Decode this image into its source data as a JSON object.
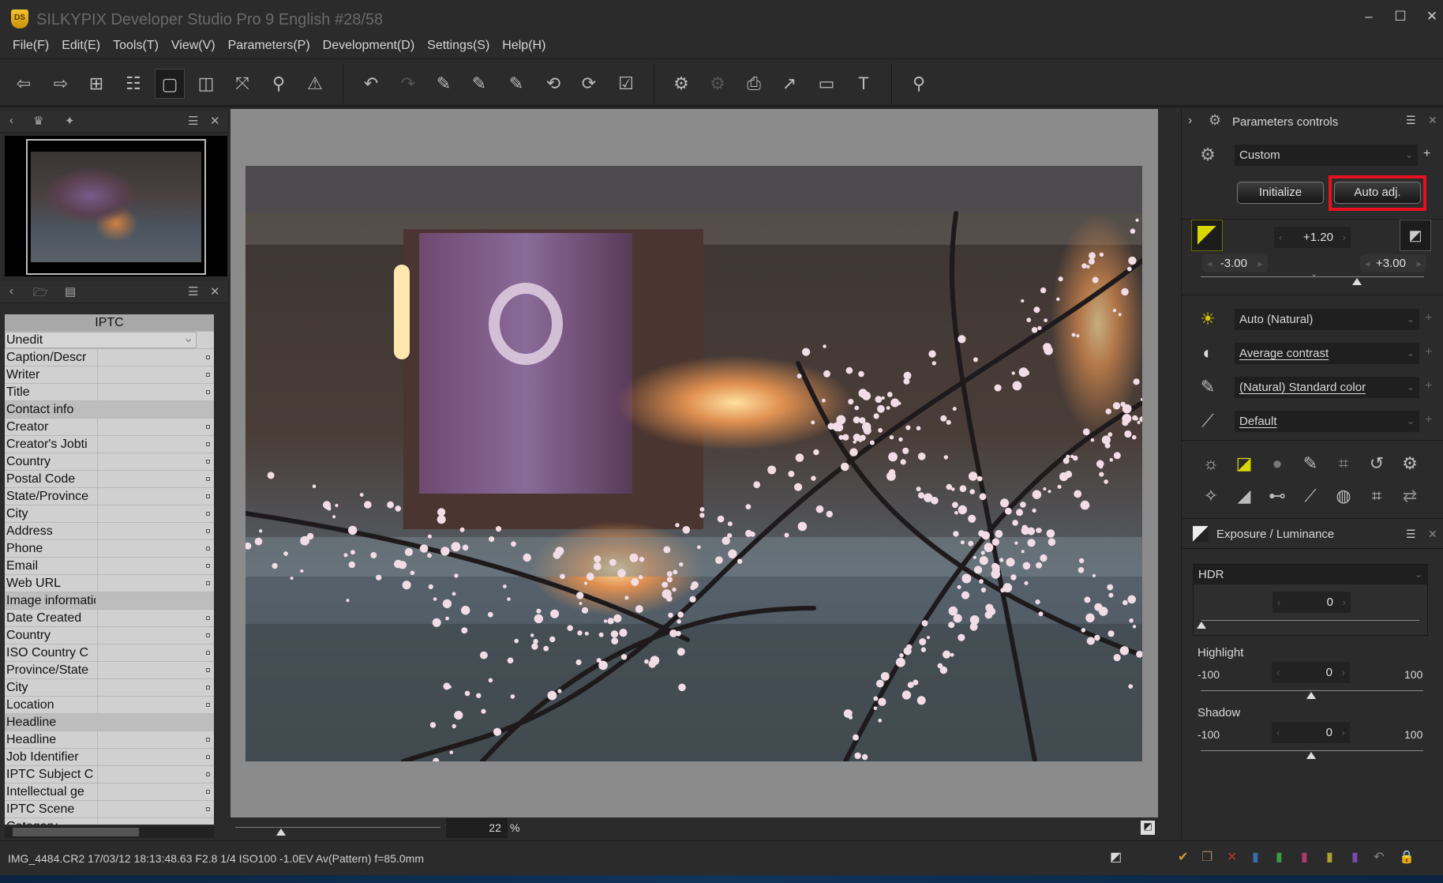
{
  "window": {
    "title": "SILKYPIX Developer Studio Pro 9 English   #28/58",
    "logo": "DS",
    "controls": [
      "minimize",
      "maximize",
      "close"
    ]
  },
  "menu": [
    "File(F)",
    "Edit(E)",
    "Tools(T)",
    "View(V)",
    "Parameters(P)",
    "Development(D)",
    "Settings(S)",
    "Help(H)"
  ],
  "toolbar": {
    "groups": [
      [
        "previous-icon",
        "next-icon",
        "thumbnail-grid-icon",
        "thumbnail-preview-icon",
        "single-preview-icon",
        "compare-icon",
        "fullscreen-icon",
        "loupe-icon",
        "warning-icon"
      ],
      [
        "undo-icon",
        "redo-icon",
        "white-balance-picker-icon",
        "gray-balance-picker-icon",
        "black-white-picker-icon",
        "rotate-left-icon",
        "rotate-right-icon",
        "mark-icon"
      ],
      [
        "save-parameters-icon",
        "apply-parameters-icon",
        "print-icon",
        "export-icon",
        "display-icon",
        "tool-icon"
      ],
      [
        "search-icon"
      ]
    ],
    "selected": "single-preview-icon"
  },
  "left_panel": {
    "top_tabs": [
      "navigator-icon",
      "histogram-icon"
    ],
    "bottom_tabs": [
      "folder-icon",
      "exif-info-icon"
    ],
    "iptc_rows": [
      {
        "type": "head",
        "label": "IPTC"
      },
      {
        "type": "drop",
        "label": "Unedit"
      },
      {
        "type": "field",
        "label": "Caption/Descr"
      },
      {
        "type": "field",
        "label": "Writer"
      },
      {
        "type": "field",
        "label": "Title"
      },
      {
        "type": "sec",
        "label": "Contact info"
      },
      {
        "type": "field",
        "label": "Creator"
      },
      {
        "type": "field",
        "label": "Creator's Jobti"
      },
      {
        "type": "field",
        "label": "Country"
      },
      {
        "type": "field",
        "label": "Postal Code"
      },
      {
        "type": "field",
        "label": "State/Province"
      },
      {
        "type": "field",
        "label": "City"
      },
      {
        "type": "field",
        "label": "Address"
      },
      {
        "type": "field",
        "label": "Phone"
      },
      {
        "type": "field",
        "label": "Email"
      },
      {
        "type": "field",
        "label": "Web URL"
      },
      {
        "type": "sec",
        "label": "Image information"
      },
      {
        "type": "field",
        "label": "Date Created"
      },
      {
        "type": "field",
        "label": "Country"
      },
      {
        "type": "field",
        "label": "ISO Country C"
      },
      {
        "type": "field",
        "label": "Province/State"
      },
      {
        "type": "field",
        "label": "City"
      },
      {
        "type": "field",
        "label": "Location"
      },
      {
        "type": "sec",
        "label": "Headline"
      },
      {
        "type": "field",
        "label": "Headline"
      },
      {
        "type": "field",
        "label": "Job Identifier"
      },
      {
        "type": "field",
        "label": "IPTC Subject C"
      },
      {
        "type": "field",
        "label": "Intellectual ge"
      },
      {
        "type": "field",
        "label": "IPTC Scene"
      },
      {
        "type": "field",
        "label": "Category"
      }
    ]
  },
  "preview": {
    "zoom_value": "22",
    "zoom_unit": "%"
  },
  "right_panel": {
    "title": "Parameters controls",
    "preset": "Custom",
    "initialize_label": "Initialize",
    "auto_adj_label": "Auto adj.",
    "highlight_color": "#e8101e",
    "exposure": {
      "value": "+1.20",
      "min": "-3.00",
      "max": "+3.00"
    },
    "white_balance": "Auto (Natural)",
    "tone": "Average contrast",
    "color": "(Natural) Standard color",
    "sharpness": "Default",
    "exposure_panel": {
      "title": "Exposure / Luminance",
      "hdr_label": "HDR",
      "hdr_value": "0",
      "highlight_label": "Highlight",
      "highlight_value": "0",
      "highlight_min": "-100",
      "highlight_max": "100",
      "shadow_label": "Shadow",
      "shadow_value": "0",
      "shadow_min": "-100",
      "shadow_max": "100"
    }
  },
  "status": {
    "text": "IMG_4484.CR2 17/03/12 18:13:48.63 F2.8 1/4 ISO100 -1.0EV Av(Pattern) f=85.0mm"
  }
}
